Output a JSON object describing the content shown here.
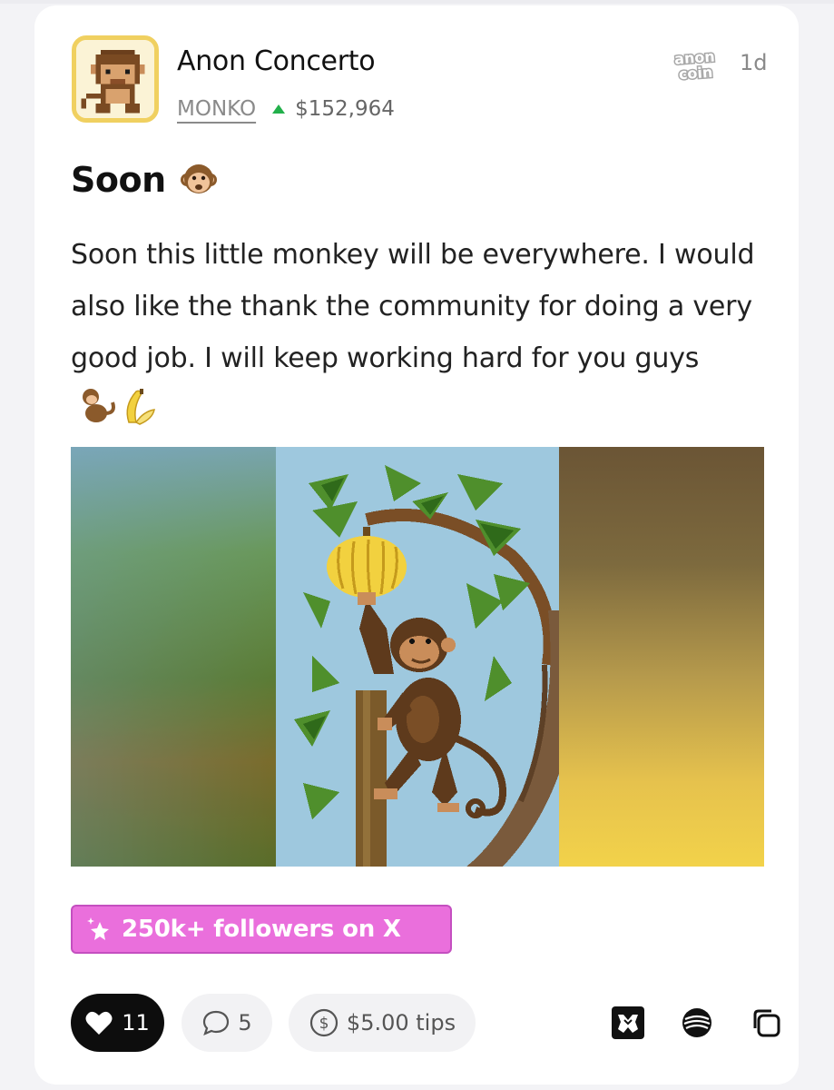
{
  "post": {
    "author_name": "Anon Concerto",
    "ticker": "MONKO",
    "price": "$152,964",
    "platform_logo": "anon coin",
    "age": "1d",
    "title": "Soon",
    "body": "Soon this little monkey will be everywhere. I would also like the thank the community for doing a very good job. I will keep working hard for you guys",
    "badge_label": "250k+ followers on X"
  },
  "actions": {
    "likes": "11",
    "comments": "5",
    "tips": "$5.00 tips"
  },
  "icons": {
    "avatar": "monkey-pixel-avatar",
    "trend": "up-arrow-icon",
    "like": "heart-icon",
    "comment": "comment-bubble-icon",
    "tip": "dollar-coin-icon",
    "badge": "sparkle-star-icon",
    "share_1": "warpcast-icon",
    "share_2": "lens-icon",
    "share_3": "copy-icon"
  },
  "colors": {
    "badge_bg": "#ea6fdc",
    "trend_up": "#22b04b",
    "avatar_border": "#f0d060",
    "like_button_bg": "#0d0d0d"
  }
}
